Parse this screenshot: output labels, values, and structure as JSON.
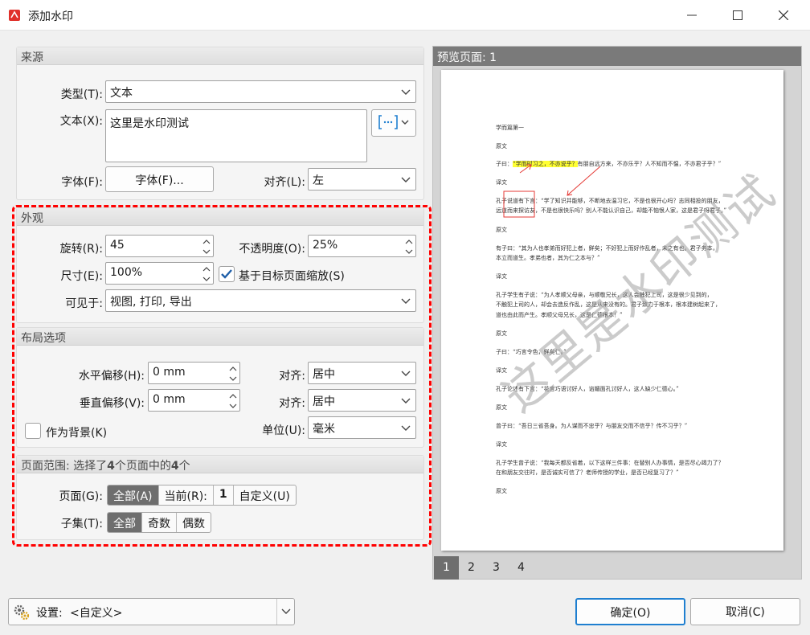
{
  "window": {
    "title": "添加水印"
  },
  "source": {
    "header": "来源",
    "type_label": "类型(T):",
    "type_value": "文本",
    "text_label": "文本(X):",
    "text_value": "这里是水印测试",
    "font_label": "字体(F):",
    "font_button": "字体(F)...",
    "align_label": "对齐(L):",
    "align_value": "左"
  },
  "appearance": {
    "header": "外观",
    "rotate_label": "旋转(R):",
    "rotate_value": "45",
    "opacity_label": "不透明度(O):",
    "opacity_value": "25%",
    "size_label": "尺寸(E):",
    "size_value": "100%",
    "scale_checkbox_label": "基于目标页面缩放(S)",
    "scale_checked": true,
    "visible_label": "可见于:",
    "visible_value": "视图, 打印, 导出"
  },
  "layout": {
    "header": "布局选项",
    "h_offset_label": "水平偏移(H):",
    "h_offset_value": "0 mm",
    "h_align_label": "对齐:",
    "h_align_value": "居中",
    "v_offset_label": "垂直偏移(V):",
    "v_offset_value": "0 mm",
    "v_align_label": "对齐:",
    "v_align_value": "居中",
    "background_label": "作为背景(K)",
    "background_checked": false,
    "unit_label": "单位(U):",
    "unit_value": "毫米"
  },
  "page_range": {
    "header_prefix": "页面范围: 选择了",
    "header_count1": "4",
    "header_mid": "个页面中的",
    "header_count2": "4",
    "header_suffix": "个",
    "pages_label": "页面(G):",
    "pages_all": "全部(A)",
    "pages_current": "当前(R):",
    "pages_current_value": "1",
    "pages_custom": "自定义(U)",
    "subset_label": "子集(T):",
    "subset_all": "全部",
    "subset_odd": "奇数",
    "subset_even": "偶数"
  },
  "preview": {
    "header": "预览页面: 1",
    "watermark_text": "这里是水印测试",
    "doc_lines": [
      "学而篇第一",
      "原文",
      "子曰：“学而时习之，不亦说乎？有朋自远方来，不亦乐乎？人不知而不愠，不亦君子乎？”",
      "译文",
      "孔子说道有下言：“学了知识并能够，不断地去温习它，不是也很开心吗？志同相投的朋友，",
      "远道而来探访友，不是也很快乐吗？别人不能认识自己，却能不恼恨人家，这是君子呀君子。”",
      "原文",
      "有子曰：“其为人也孝弟而好犯上者，鲜矣；不好犯上而好作乱者，未之有也。君子务本，",
      "本立而道生。孝弟也者，其为仁之本与？”",
      "译文",
      "孔子学生有子说：“为人孝顺父母亲，与顺敬兄长，这人会触犯上司，这是很少见到的，",
      "不触犯上司的人，却会去造反作乱，这是从来没有的。君子致力于根本，根本建树起来了，",
      "道也由此而产生。孝顺父母兄长，这是仁德根本！”",
      "原文",
      "子曰：“巧言令色，鲜矣仁。”",
      "译文",
      "孔子论述有下言：“花言巧语讨好人，谄媚面孔讨好人，这人缺少仁德心。”",
      "原文",
      "曾子曰：“吾日三省吾身。为人谋而不忠乎？与朋友交而不信乎？传不习乎？”",
      "译文",
      "孔子学生曾子说：“我每天都反省着，以下这样三件事：在替别人办事情，是否尽心竭力了？",
      "在和朋友交往时，是否诚实可信了？老师传授的学业，是否已经复习了？”",
      "原文"
    ],
    "page_tabs": [
      "1",
      "2",
      "3",
      "4"
    ],
    "active_tab": "1"
  },
  "footer": {
    "settings_label": "设置:",
    "settings_value": "<自定义>",
    "ok_button": "确定(O)",
    "cancel_button": "取消(C)"
  },
  "colors": {
    "highlight_dash": "#ff0000",
    "active_segment": "#6e6e6e",
    "check_accent": "#1f5fa8"
  }
}
